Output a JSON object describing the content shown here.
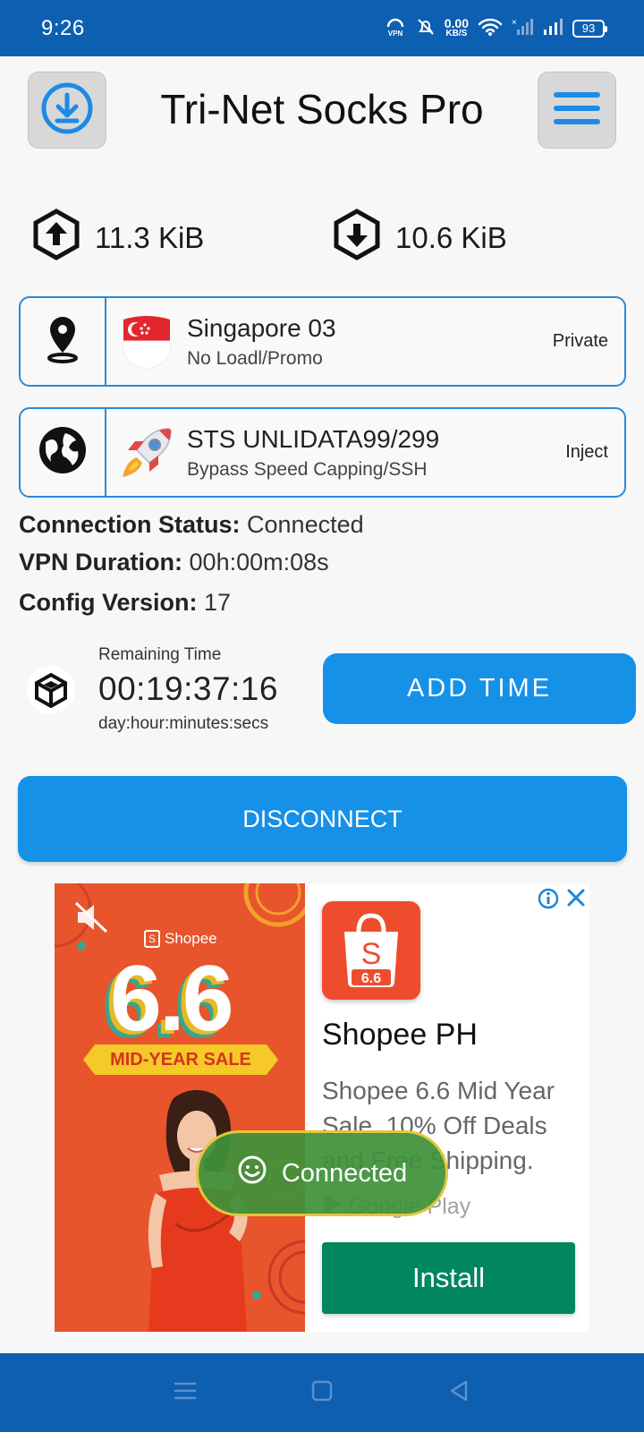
{
  "status_bar": {
    "time": "9:26",
    "vpn_label": "VPN",
    "net_speed_value": "0.00",
    "net_speed_unit": "KB/S",
    "battery": "93"
  },
  "header": {
    "title": "Tri-Net Socks Pro"
  },
  "traffic": {
    "upload": "11.3 KiB",
    "download": "10.6 KiB"
  },
  "server": {
    "name": "Singapore 03",
    "subtitle": "No Loadl/Promo",
    "tag": "Private"
  },
  "payload": {
    "name": "STS UNLIDATA99/299",
    "subtitle": "Bypass Speed Capping/SSH",
    "tag": "Inject"
  },
  "status": {
    "connection_label": "Connection Status:",
    "connection_value": "Connected",
    "duration_label": "VPN Duration:",
    "duration_value": "00h:00m:08s",
    "config_label": "Config Version:",
    "config_value": "17"
  },
  "remaining": {
    "label": "Remaining Time",
    "value": "00:19:37:16",
    "format": "day:hour:minutes:secs",
    "add_time_label": "ADD TIME"
  },
  "disconnect_label": "DISCONNECT",
  "ad": {
    "banner_brand": "Shopee",
    "banner_big": "6.6",
    "banner_sale": "MID-YEAR SALE",
    "logo_text": "6.6",
    "app_name": "Shopee PH",
    "description": "Shopee 6.6 Mid Year Sale, 10% Off Deals and Free Shipping.",
    "store": "Google Play",
    "install_label": "Install"
  },
  "toast": {
    "text": "Connected"
  },
  "colors": {
    "status_bar": "#0d5fb2",
    "primary_button": "#1591e8",
    "card_border": "#2a8ad8",
    "install": "#01875f",
    "toast": "#3e913a"
  }
}
